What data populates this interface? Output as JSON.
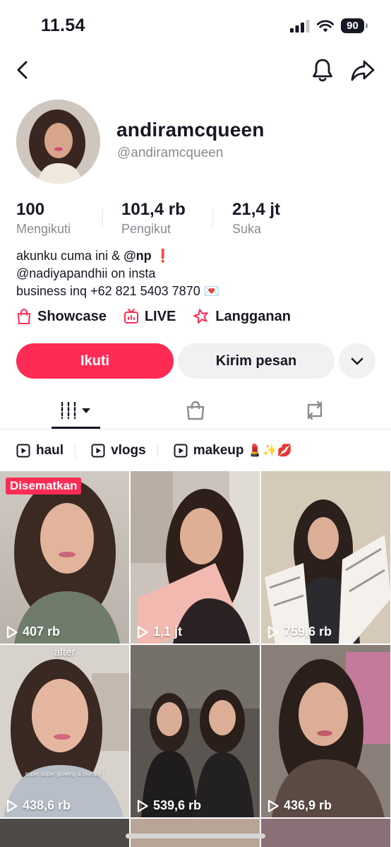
{
  "status_bar": {
    "time": "11.54",
    "battery": "90"
  },
  "profile": {
    "display_name": "andiramcqueen",
    "handle": "@andiramcqueen",
    "stats": [
      {
        "value": "100",
        "label": "Mengikuti"
      },
      {
        "value": "101,4 rb",
        "label": "Pengikut"
      },
      {
        "value": "21,4 jt",
        "label": "Suka"
      }
    ],
    "bio": {
      "line1_text": "akunku cuma ini & ",
      "line1_mention": "@np",
      "line1_emoji": "❗",
      "line2": "@nadiyapandhii on insta",
      "line3": "business inq +62 821 5403 7870",
      "line3_emoji": "💌"
    },
    "links": [
      {
        "label": "Showcase",
        "icon": "shopping-bag-icon"
      },
      {
        "label": "LIVE",
        "icon": "live-tv-icon"
      },
      {
        "label": "Langganan",
        "icon": "subscription-star-icon"
      }
    ]
  },
  "actions": {
    "follow": "Ikuti",
    "message": "Kirim pesan"
  },
  "tabs": [
    {
      "name": "videos",
      "icon": "grid-icon",
      "active": true
    },
    {
      "name": "shop",
      "icon": "shop-bag-icon",
      "active": false
    },
    {
      "name": "reposts",
      "icon": "repost-icon",
      "active": false
    }
  ],
  "playlists": [
    {
      "label": "haul",
      "emoji": ""
    },
    {
      "label": "vlogs",
      "emoji": ""
    },
    {
      "label": "makeup",
      "emoji": "💄✨💋"
    }
  ],
  "videos": [
    {
      "views": "407 rb",
      "pinned_label": "Disematkan",
      "overlay": ""
    },
    {
      "views": "1,1 jt",
      "pinned_label": "",
      "overlay": ""
    },
    {
      "views": "759,6 rb",
      "pinned_label": "",
      "overlay": ""
    },
    {
      "views": "438,6 rb",
      "pinned_label": "",
      "overlay": "after",
      "caption": "super duper glowing & plumpy !"
    },
    {
      "views": "539,6 rb",
      "pinned_label": "",
      "overlay": ""
    },
    {
      "views": "436,9 rb",
      "pinned_label": "",
      "overlay": ""
    }
  ],
  "colors": {
    "accent": "#fe2c55",
    "text": "#161823",
    "secondary_text": "#8a8b91",
    "button_bg": "#f1f1f2"
  }
}
